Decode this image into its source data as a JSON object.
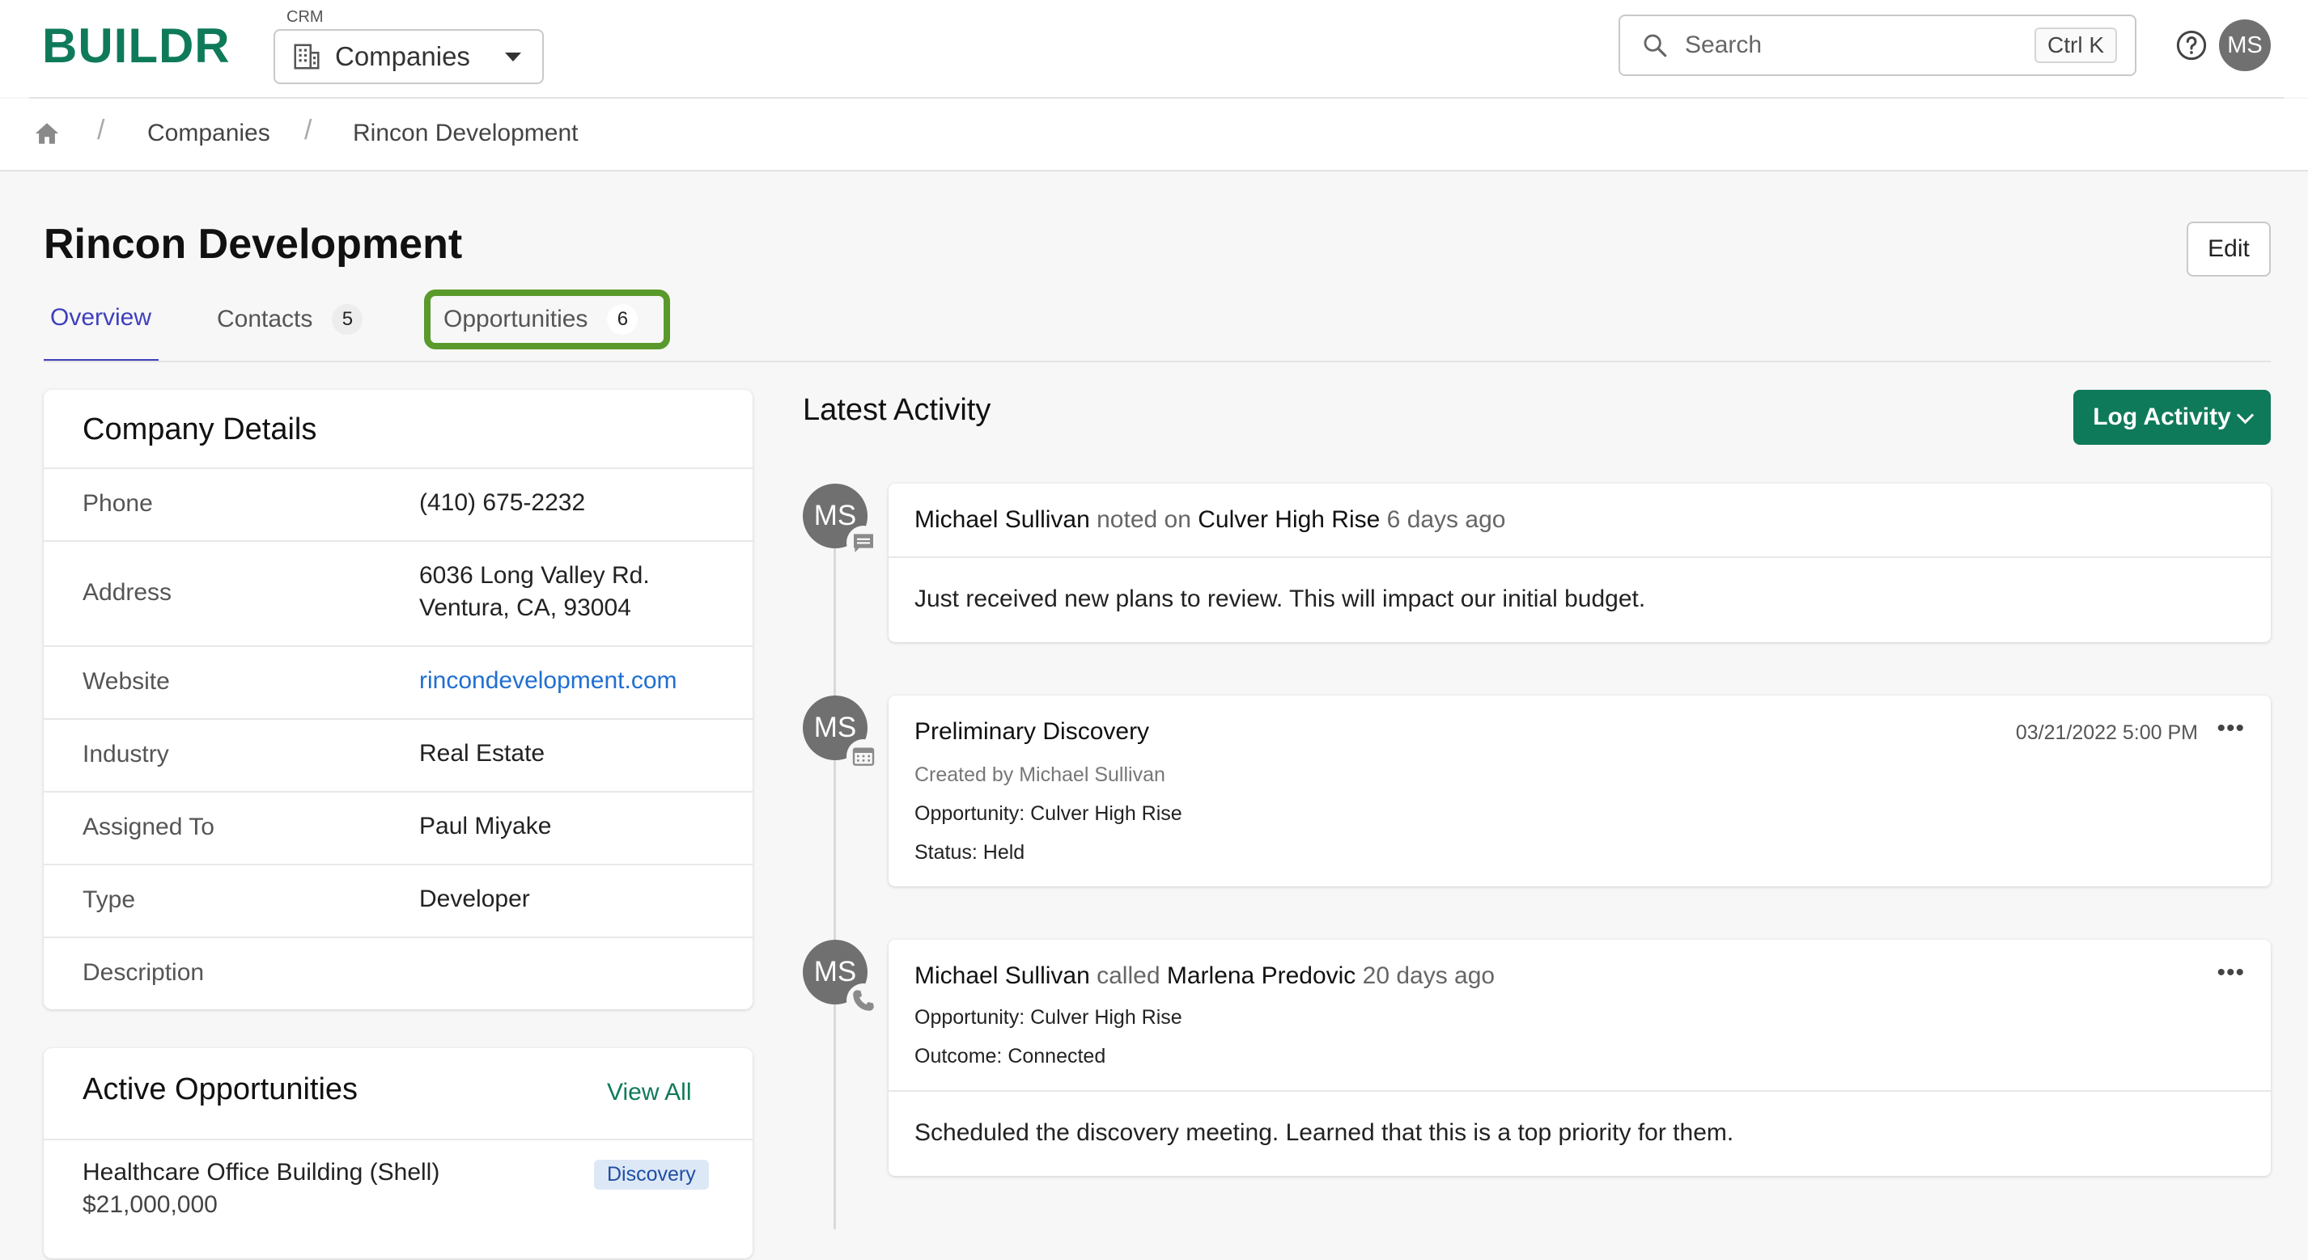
{
  "brand": {
    "logo": "BUILDR",
    "accent": "#0f7a5a"
  },
  "app_switcher": {
    "label": "CRM",
    "current": "Companies",
    "icon": "building-icon"
  },
  "search": {
    "placeholder": "Search",
    "shortcut": "Ctrl K"
  },
  "user": {
    "initials": "MS"
  },
  "breadcrumb": {
    "items": [
      "Companies",
      "Rincon Development"
    ]
  },
  "page": {
    "title": "Rincon Development",
    "edit_label": "Edit"
  },
  "tabs": [
    {
      "label": "Overview",
      "count": null
    },
    {
      "label": "Contacts",
      "count": "5"
    },
    {
      "label": "Opportunities",
      "count": "6"
    }
  ],
  "details": {
    "title": "Company Details",
    "rows": [
      {
        "label": "Phone",
        "value": "(410) 675-2232"
      },
      {
        "label": "Address",
        "value_line1": "6036 Long Valley Rd.",
        "value_line2": "Ventura, CA, 93004"
      },
      {
        "label": "Website",
        "value": "rincondevelopment.com"
      },
      {
        "label": "Industry",
        "value": "Real Estate"
      },
      {
        "label": "Assigned To",
        "value": "Paul Miyake"
      },
      {
        "label": "Type",
        "value": "Developer"
      },
      {
        "label": "Description",
        "value": ""
      }
    ]
  },
  "opportunities": {
    "title": "Active Opportunities",
    "view_all": "View All",
    "items": [
      {
        "name": "Healthcare Office Building (Shell)",
        "amount": "$21,000,000",
        "stage": "Discovery"
      }
    ]
  },
  "activity": {
    "title": "Latest Activity",
    "log_button": "Log Activity",
    "items": [
      {
        "type": "note",
        "icon": "note-icon",
        "author": "Michael Sullivan",
        "verb": "noted on",
        "target": "Culver High Rise",
        "time": "6 days ago",
        "body": "Just received new plans to review. This will impact our initial budget."
      },
      {
        "type": "meeting",
        "icon": "calendar-icon",
        "title": "Preliminary Discovery",
        "date": "03/21/2022 5:00 PM",
        "created_by": "Created by Michael Sullivan",
        "opportunity": "Opportunity: Culver High Rise",
        "status": "Status: Held"
      },
      {
        "type": "call",
        "icon": "phone-icon",
        "author": "Michael Sullivan",
        "verb": "called",
        "target": "Marlena Predovic",
        "time": "20 days ago",
        "opportunity": "Opportunity: Culver High Rise",
        "outcome": "Outcome: Connected",
        "body": "Scheduled the discovery meeting. Learned that this is a top priority for them."
      }
    ]
  }
}
